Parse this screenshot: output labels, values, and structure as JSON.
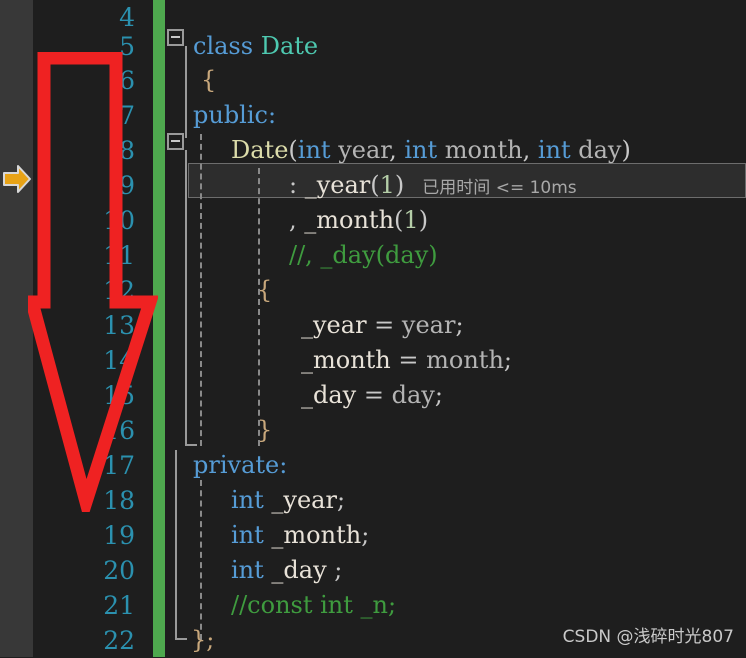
{
  "editor": {
    "language": "cpp",
    "accent_linenumber_color": "#2b91af",
    "change_bar_color": "#4ea84e",
    "background_color": "#1e1e1e",
    "annotation_arrow_color": "#ef2222",
    "step_arrow_color": "#e8a317"
  },
  "gutter": {
    "step_arrow_icon": "current-statement-arrow-icon",
    "step_arrow_line": 9
  },
  "line_numbers": [
    "4",
    "5",
    "6",
    "7",
    "8",
    "9",
    "10",
    "11",
    "12",
    "13",
    "14",
    "15",
    "16",
    "17",
    "18",
    "19",
    "20",
    "21",
    "22"
  ],
  "lines": [
    {
      "n": "4",
      "text": ""
    },
    {
      "n": "5",
      "text": "class Date"
    },
    {
      "n": "6",
      "text": "{"
    },
    {
      "n": "7",
      "text": "public:"
    },
    {
      "n": "8",
      "text": "    Date(int year, int month, int day)"
    },
    {
      "n": "9",
      "text": "        : _year(1)"
    },
    {
      "n": "10",
      "text": "        , _month(1)"
    },
    {
      "n": "11",
      "text": "        //, _day(day)"
    },
    {
      "n": "12",
      "text": "    {"
    },
    {
      "n": "13",
      "text": "        _year = year;"
    },
    {
      "n": "14",
      "text": "        _month = month;"
    },
    {
      "n": "15",
      "text": "        _day = day;"
    },
    {
      "n": "16",
      "text": "    }"
    },
    {
      "n": "17",
      "text": "private:"
    },
    {
      "n": "18",
      "text": "    int _year;"
    },
    {
      "n": "19",
      "text": "    int _month;"
    },
    {
      "n": "20",
      "text": "    int _day ;"
    },
    {
      "n": "21",
      "text": "    //const int _n;"
    },
    {
      "n": "22",
      "text": "};"
    }
  ],
  "tokens": {
    "kw_class": "class",
    "type_date": "Date",
    "brace_open": "{",
    "kw_public": "public:",
    "ctor_name": "Date",
    "paren_open": "(",
    "kw_int": "int",
    "param_year": "year",
    "comma_sp": ", ",
    "param_month": "month",
    "param_day": "day",
    "paren_close": ")",
    "init_colon": ": ",
    "member_year": "_year",
    "literal_one": "1",
    "init_comma": ", ",
    "member_month": "_month",
    "comment_day_init": "//, _day(day)",
    "body_open": "{",
    "assign_year": "_year",
    "eq": " = ",
    "semi": ";",
    "assign_month": "_month",
    "assign_day": "_day",
    "body_close": "}",
    "kw_private": "private:",
    "decl_year": "_year",
    "decl_month": "_month",
    "decl_day": "_day ",
    "comment_const_n": "//const int _n;",
    "class_close": "};"
  },
  "codelens": {
    "text": "已用时间 <= 10ms",
    "line": 9,
    "highlight_background": "#2d2d2d",
    "border_color": "#6d6d6d"
  },
  "watermark": {
    "text": "CSDN @浅碎时光807"
  },
  "annotation": {
    "type": "down-arrow",
    "spans_lines": "6-19",
    "color": "#ef2222"
  }
}
